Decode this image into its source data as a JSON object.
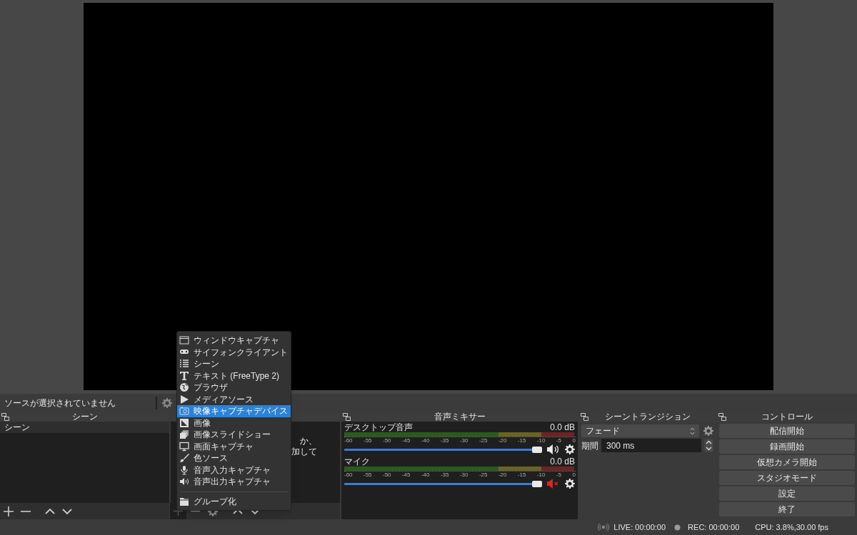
{
  "source_bar": {
    "label": "ソースが選択されていません"
  },
  "scenes": {
    "title": "シーン",
    "items": [
      {
        "label": "シーン",
        "selected": true
      }
    ]
  },
  "sources": {
    "hint_lines": [
      "か、",
      "加して"
    ]
  },
  "mixer": {
    "title": "音声ミキサー",
    "channels": [
      {
        "name": "デスクトップ音声",
        "reading": "0.0 dB",
        "level": 1,
        "muted": false,
        "scale": [
          "-60",
          "-55",
          "-50",
          "-45",
          "-40",
          "-35",
          "-30",
          "-25",
          "-20",
          "-15",
          "-10",
          "-5",
          "0"
        ]
      },
      {
        "name": "マイク",
        "reading": "0.0 dB",
        "level": 1,
        "muted": true,
        "scale": [
          "-60",
          "-55",
          "-50",
          "-45",
          "-40",
          "-35",
          "-30",
          "-25",
          "-20",
          "-15",
          "-10",
          "-5",
          "0"
        ]
      }
    ]
  },
  "transitions": {
    "title": "シーントランジション",
    "transition": "フェード",
    "duration_label": "期間",
    "duration": "300 ms"
  },
  "controls": {
    "title": "コントロール",
    "buttons": [
      "配信開始",
      "録画開始",
      "仮想カメラ開始",
      "スタジオモード",
      "設定",
      "終了"
    ]
  },
  "add_source_menu": {
    "items": [
      {
        "kind": "item",
        "label": "ウィンドウキャプチャ",
        "selected": false
      },
      {
        "kind": "item",
        "label": "サイフォンクライアント",
        "selected": false
      },
      {
        "kind": "item",
        "label": "シーン",
        "selected": false
      },
      {
        "kind": "item",
        "label": "テキスト (FreeType 2)",
        "selected": false
      },
      {
        "kind": "item",
        "label": "ブラウザ",
        "selected": false
      },
      {
        "kind": "item",
        "label": "メディアソース",
        "selected": false
      },
      {
        "kind": "item",
        "label": "映像キャプチャデバイス",
        "selected": true
      },
      {
        "kind": "item",
        "label": "画像",
        "selected": false
      },
      {
        "kind": "item",
        "label": "画像スライドショー",
        "selected": false
      },
      {
        "kind": "item",
        "label": "画面キャプチャ",
        "selected": false
      },
      {
        "kind": "item",
        "label": "色ソース",
        "selected": false
      },
      {
        "kind": "item",
        "label": "音声入力キャプチャ",
        "selected": false
      },
      {
        "kind": "item",
        "label": "音声出力キャプチャ",
        "selected": false
      },
      {
        "kind": "separator"
      },
      {
        "kind": "item",
        "label": "グループ化",
        "selected": false
      }
    ]
  },
  "status_bar": {
    "live": "LIVE: 00:00:00",
    "rec": "REC: 00:00:00",
    "cpu": "CPU: 3.8%,30.00 fps"
  }
}
